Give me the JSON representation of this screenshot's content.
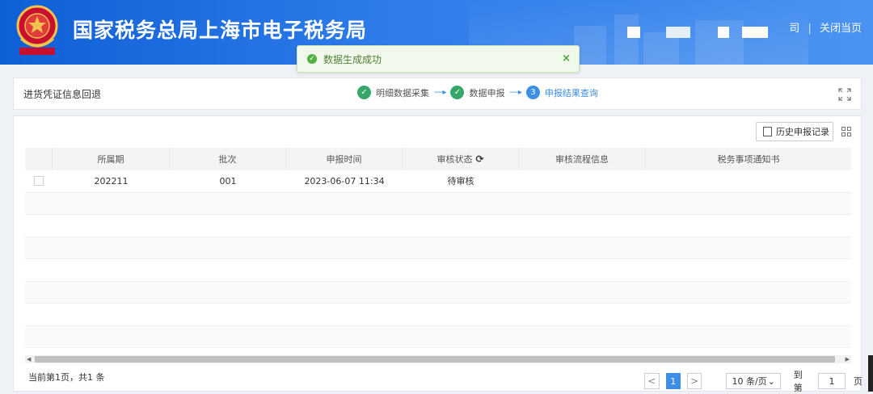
{
  "header": {
    "site_title": "国家税务总局上海市电子税务局",
    "link_partial": "司",
    "close_page": "关闭当页"
  },
  "toast": {
    "message": "数据生成成功",
    "close_symbol": "×"
  },
  "steps_panel": {
    "page_title": "进货凭证信息回退",
    "steps": [
      {
        "index": "✓",
        "label": "明细数据采集",
        "state": "done"
      },
      {
        "index": "✓",
        "label": "数据申报",
        "state": "done"
      },
      {
        "index": "3",
        "label": "申报结果查询",
        "state": "current"
      }
    ],
    "arrow": "----▸"
  },
  "toolbar": {
    "history_button": "历史申报记录"
  },
  "table": {
    "headers": [
      "",
      "所属期",
      "批次",
      "申报时间",
      "审核状态",
      "审核流程信息",
      "税务事项通知书"
    ],
    "rows": [
      {
        "period": "202211",
        "batch": "001",
        "time": "2023-06-07 11:34",
        "status": "待审核",
        "flow": "",
        "notice": ""
      }
    ]
  },
  "footer": {
    "page_info": "当前第1页，共1 条",
    "prev": "<",
    "current_page": "1",
    "next": ">",
    "page_size": "10 条/页",
    "goto_label": "到第",
    "goto_value": "1",
    "goto_unit": "页"
  },
  "colors": {
    "header_blue": "#1f6fe0",
    "accent_blue": "#3d8fe6",
    "step_done_green": "#36a66b",
    "toast_bg": "#f0f9eb"
  }
}
